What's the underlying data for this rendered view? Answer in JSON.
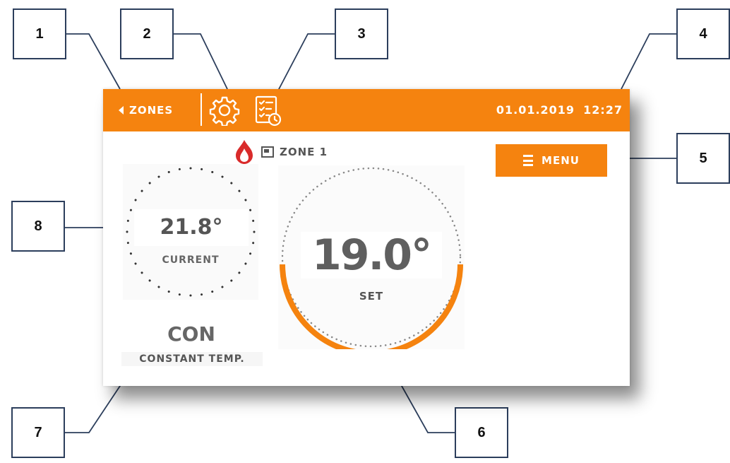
{
  "callouts": [
    "1",
    "2",
    "3",
    "4",
    "5",
    "6",
    "7",
    "8"
  ],
  "topbar": {
    "back_label": "ZONES",
    "back_icon": "triangle-left-icon",
    "settings_icon": "gear-icon",
    "schedule_icon": "schedule-checklist-icon",
    "date": "01.01.2019",
    "time": "12:27"
  },
  "zone": {
    "name": "ZONE 1",
    "heating_icon": "flame-icon",
    "zone_icon": "zone-square-icon"
  },
  "menu": {
    "label": "MENU",
    "icon": "hamburger-icon"
  },
  "current": {
    "value": "21.8°",
    "label": "CURRENT"
  },
  "setpoint": {
    "value": "19.0°",
    "label": "SET"
  },
  "mode": {
    "code": "CON",
    "name": "CONSTANT TEMP."
  },
  "colors": {
    "accent": "#f5830f",
    "flame": "#d92b2b",
    "text": "#5f5f5f"
  }
}
